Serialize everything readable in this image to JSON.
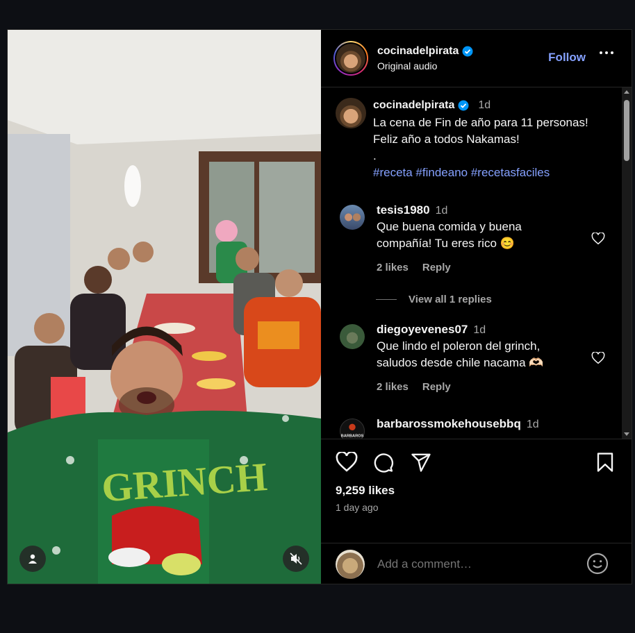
{
  "post": {
    "username": "cocinadelpirata",
    "subtitle": "Original audio",
    "follow_label": "Follow"
  },
  "caption": {
    "username": "cocinadelpirata",
    "time": "1d",
    "line1": "La cena de Fin de año para 11 personas!",
    "line2": "Feliz año a todos Nakamas!",
    "line3": ".",
    "hashtags": "#receta #findeano #recetasfaciles"
  },
  "comments": [
    {
      "username": "tesis1980",
      "time": "1d",
      "line1": "Que buena comida y buena",
      "line2": "compañía! Tu eres rico 😊",
      "likes": "2 likes",
      "reply": "Reply"
    },
    {
      "username": "diegoyevenes07",
      "time": "1d",
      "line1": "Que lindo el poleron del grinch,",
      "line2": "saludos desde chile nacama 🫶🏻",
      "likes": "2 likes",
      "reply": "Reply"
    },
    {
      "username": "barbarossmokehousebbq",
      "time": "1d",
      "avatar_text": "BARBAROS"
    }
  ],
  "view_replies": "View all 1 replies",
  "stats": {
    "likes": "9,259 likes",
    "ago": "1 day ago"
  },
  "composer": {
    "placeholder": "Add a comment…"
  },
  "icons": {
    "verified": "verified-badge-icon",
    "heart": "heart-icon",
    "comment": "comment-icon",
    "share": "share-icon",
    "save": "bookmark-icon",
    "emoji": "emoji-icon",
    "user_tag": "user-tag-icon",
    "mute": "muted-speaker-icon"
  },
  "colors": {
    "accent": "#85a1ff",
    "verified": "#0095f6",
    "background": "#000000"
  }
}
